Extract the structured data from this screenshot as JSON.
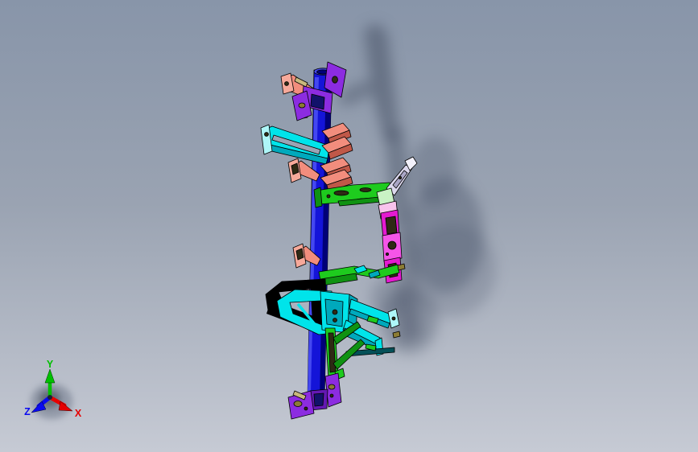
{
  "viewport": {
    "background_top": "#8895a9",
    "background_bottom": "#c6cad4"
  },
  "triad": {
    "labels": {
      "x": "X",
      "y": "Y",
      "z": "Z"
    },
    "colors": {
      "x": "#e60000",
      "y": "#00c000",
      "z": "#0a0af0"
    }
  },
  "model": {
    "colors": {
      "beam": "#1414d8",
      "beam_dark": "#000078",
      "beam_light": "#4448f0",
      "purple": "#8c2ce0",
      "purple_dark": "#6418b4",
      "navy": "#12126a",
      "salmon": "#f28d7d",
      "salmon_light": "#f7a99a",
      "salmon_dark": "#c05848",
      "tan": "#c9b97c",
      "olive": "#8c7c34",
      "cyan": "#00e4ea",
      "cyan_dark": "#00a9bc",
      "cyan_light": "#aef6f8",
      "teal_deep": "#045058",
      "green": "#1ecb1e",
      "green_dark": "#0f9212",
      "green_light": "#c9f2c4",
      "lavender": "#dcd8ee",
      "lavender_light": "#f2f0fa",
      "lavender_dark": "#aaa6c6",
      "pink": "#f9c3ec",
      "magenta": "#e41ad0",
      "magenta_bright": "#f555e8",
      "slot": "#2e2a14",
      "bg_through": "#9aa4b4",
      "shadow": "#414b60"
    }
  }
}
